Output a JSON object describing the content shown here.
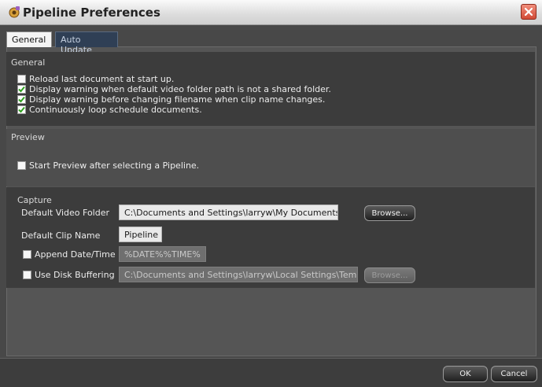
{
  "window": {
    "title": "Pipeline Preferences"
  },
  "tabs": [
    {
      "label": "General",
      "active": true
    },
    {
      "label": "Auto Update",
      "active": false
    }
  ],
  "general": {
    "title": "General",
    "options": [
      {
        "label": "Reload last document at start up.",
        "checked": false
      },
      {
        "label": "Display warning when default video folder path is not a shared folder.",
        "checked": true
      },
      {
        "label": "Display warning before changing filename when clip name changes.",
        "checked": true
      },
      {
        "label": "Continuously loop schedule documents.",
        "checked": true
      }
    ]
  },
  "preview": {
    "title": "Preview",
    "option": {
      "label": "Start Preview after selecting a Pipeline.",
      "checked": false
    }
  },
  "capture": {
    "title": "Capture",
    "video_folder_label": "Default Video Folder",
    "video_folder_value": "C:\\Documents and Settings\\larryw\\My Documents",
    "browse_label": "Browse...",
    "clip_name_label": "Default Clip Name",
    "clip_name_value": "Pipeline",
    "append_label": "Append Date/Time",
    "append_checked": false,
    "append_value": "%DATE%%TIME%",
    "disk_buffer_label": "Use Disk Buffering",
    "disk_buffer_checked": false,
    "disk_buffer_value": "C:\\Documents and Settings\\larryw\\Local Settings\\Temp\\",
    "browse2_label": "Browse..."
  },
  "footer": {
    "ok_label": "OK",
    "cancel_label": "Cancel"
  },
  "colors": {
    "check": "#2fa11f",
    "close": "#d14a36"
  }
}
